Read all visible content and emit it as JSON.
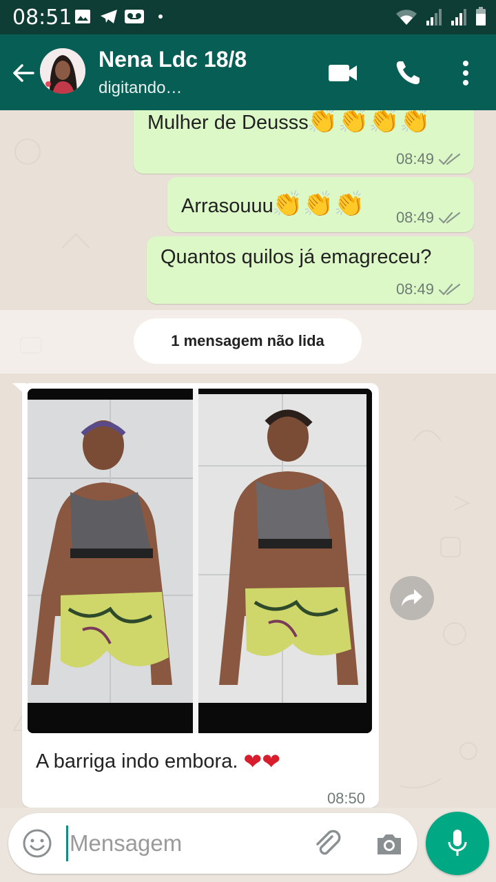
{
  "status_bar": {
    "time": "08:51",
    "left_icons": [
      "gallery-icon",
      "telegram-icon",
      "voicemail-icon",
      "dot-icon"
    ],
    "right_icons": [
      "wifi-icon",
      "signal-icon",
      "signal-icon",
      "battery-icon"
    ]
  },
  "header": {
    "contact_name": "Nena Ldc 18/8",
    "status": "digitando…",
    "icons": [
      "back-arrow-icon",
      "video-call-icon",
      "phone-icon",
      "more-vert-icon"
    ]
  },
  "messages": [
    {
      "direction": "out",
      "text": "Mulher de Deusss",
      "emoji": "👏👏👏👏",
      "time": "08:49",
      "status": "read"
    },
    {
      "direction": "out",
      "text": "Arrasouuu",
      "emoji": "👏👏👏",
      "time": "08:49",
      "status": "read"
    },
    {
      "direction": "out",
      "text": "Quantos quilos já emagreceu?",
      "emoji": "",
      "time": "08:49",
      "status": "read"
    },
    {
      "direction": "in",
      "type": "image",
      "caption": "A barriga  indo embora.",
      "emoji": "❤❤",
      "time": "08:50"
    }
  ],
  "unread_label": "1 mensagem não lida",
  "composer": {
    "placeholder": "Mensagem",
    "icons": [
      "emoji-icon",
      "attach-icon",
      "camera-icon",
      "mic-icon"
    ]
  },
  "colors": {
    "header": "#075e54",
    "status_bar": "#0e3d36",
    "outgoing_bubble": "#dcf8c6",
    "incoming_bubble": "#ffffff",
    "accent": "#00a884",
    "read_ticks": "#8a9590"
  }
}
